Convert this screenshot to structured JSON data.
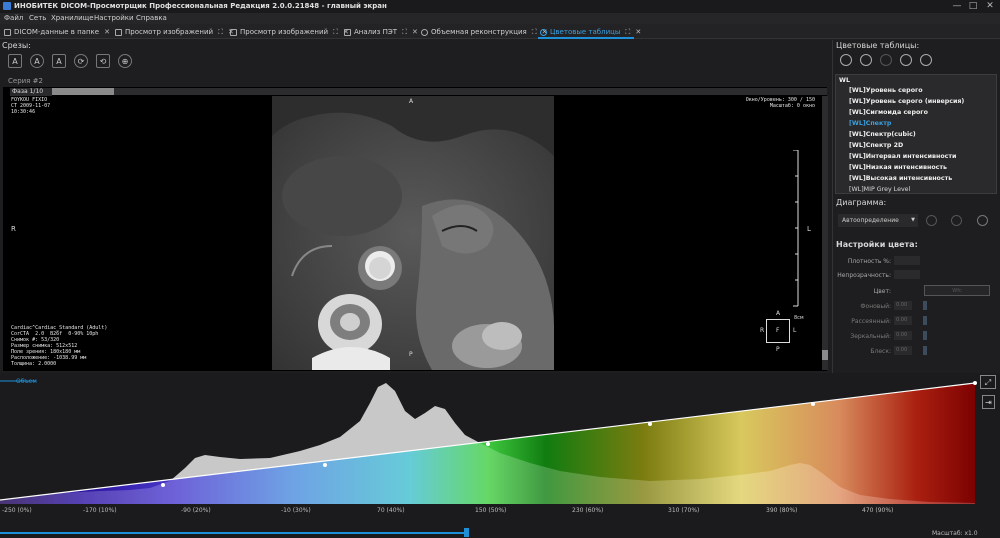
{
  "titlebar": {
    "title": "ИНОБИТЕК DICOM-Просмотрщик Профессиональная Редакция 2.0.0.21848 - главный экран",
    "minimize": "—",
    "maximize": "□",
    "close": "✕"
  },
  "menu": [
    "Файл",
    "Сеть",
    "Хранилище",
    "Настройки",
    "Справка"
  ],
  "tabs": [
    {
      "label": "DICOM-данные в папке",
      "active": false
    },
    {
      "label": "Просмотр изображений",
      "active": false
    },
    {
      "label": "Просмотр изображений",
      "active": false
    },
    {
      "label": "Анализ ПЭТ",
      "active": false
    },
    {
      "label": "Объемная реконструкция",
      "active": false
    },
    {
      "label": "Цветовые таблицы",
      "active": true
    }
  ],
  "slices": {
    "label": "Срезы:",
    "series": "Серия #2",
    "phase": "Фаза 1/10",
    "tools": [
      "A",
      "A",
      "A",
      "⟳",
      "⟲",
      "⊕"
    ]
  },
  "overlay": {
    "top_left": "FOYKOU FIXIO\nCT 2009-11-07\n10:30:46",
    "top_right": "Окно/Уровень: 300 / 150\nМасштаб: 0 окно",
    "bottom_left": "Cardiac^Cardiac_Standard (Adult)\nCorCTA  2.0  B26f  0-90% 10ph\nСнимок #: 53/320\nРазмер снимка: 512x512\nПоле зрения: 180x180 мм\nРасположение: -1038.99 мм\nТолщина: 2.0000",
    "orient_top": "A",
    "orient_bottom": "P",
    "orient_left": "R",
    "orient_right": "L",
    "scale_label": "8см",
    "cube": {
      "top": "A",
      "bottom": "P",
      "left": "R",
      "right": "L",
      "center": "F"
    }
  },
  "color_tables": {
    "label": "Цветовые таблицы:",
    "group": "WL",
    "items": [
      {
        "label": "[WL]Уровень серого",
        "selected": false,
        "bold": true
      },
      {
        "label": "[WL]Уровень серого (инверсия)",
        "selected": false,
        "bold": true
      },
      {
        "label": "[WL]Сигмоида серого",
        "selected": false,
        "bold": true
      },
      {
        "label": "[WL]Спектр",
        "selected": true,
        "bold": true
      },
      {
        "label": "[WL]Спектр(cubic)",
        "selected": false,
        "bold": true
      },
      {
        "label": "[WL]Спектр 2D",
        "selected": false,
        "bold": true
      },
      {
        "label": "[WL]Интервал интенсивности",
        "selected": false,
        "bold": true
      },
      {
        "label": "[WL]Низкая интенсивность",
        "selected": false,
        "bold": true
      },
      {
        "label": "[WL]Высокая интенсивность",
        "selected": false,
        "bold": true
      },
      {
        "label": "[WL]MIP Grey Level",
        "selected": false,
        "bold": false
      }
    ]
  },
  "diagram": {
    "label": "Диаграмма:",
    "select_value": "Автоопределение"
  },
  "color_settings": {
    "label": "Настройки цвета:",
    "fields": [
      {
        "label": "Плотность %:",
        "dim": false,
        "value": ""
      },
      {
        "label": "Непрозрачность:",
        "dim": false,
        "value": ""
      },
      {
        "label": "Цвет:",
        "dim": false,
        "value": ""
      },
      {
        "label": "Фоновый:",
        "dim": true,
        "value": "0.00"
      },
      {
        "label": "Рассеянный:",
        "dim": true,
        "value": "0.00"
      },
      {
        "label": "Зеркальный:",
        "dim": true,
        "value": "0.00"
      },
      {
        "label": "Блеск:",
        "dim": true,
        "value": "0.00"
      }
    ],
    "color_value": "Wfc"
  },
  "histogram": {
    "legend": "Объем",
    "scale": "Масштаб: x1.0",
    "ticks": [
      "-250 (0%)",
      "-170 (10%)",
      "-90 (20%)",
      "-10 (30%)",
      "70 (40%)",
      "150 (50%)",
      "230 (60%)",
      "310 (70%)",
      "390 (80%)",
      "470 (90%)"
    ],
    "colors": {
      "accent": "#1e90d8",
      "curve": "#ffffff"
    }
  }
}
